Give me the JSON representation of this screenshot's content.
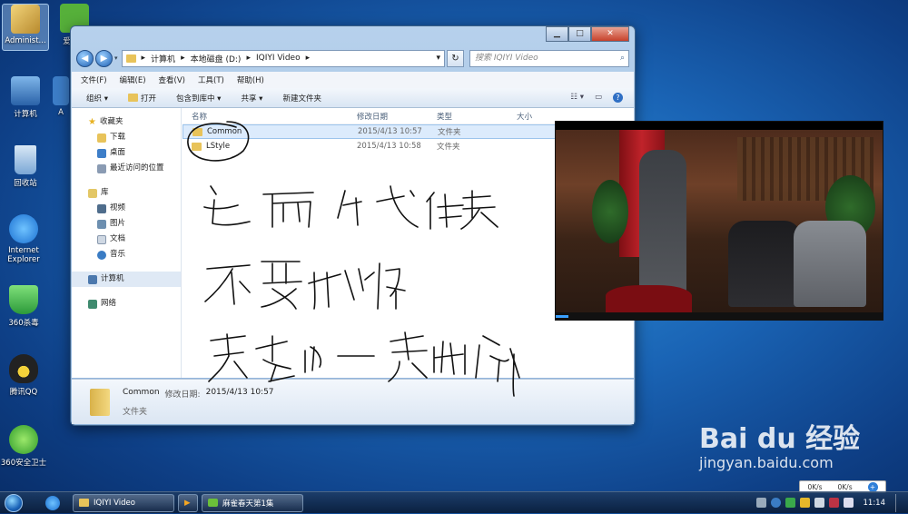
{
  "desktop": {
    "icons": [
      {
        "label": "Administ...",
        "color": "#caa24a"
      },
      {
        "label": "爱奇艺",
        "color": "#56b03a"
      },
      {
        "label": "计算机",
        "color": "#3d7ec8"
      },
      {
        "label": "A",
        "color": "#3d7ec8"
      },
      {
        "label": "回收站",
        "color": "#7aa7d6"
      },
      {
        "label": "Internet Explorer",
        "color": "#2f8fe0"
      },
      {
        "label": "360杀毒",
        "color": "#3aa84a"
      },
      {
        "label": "腾讯QQ",
        "color": "#222222"
      },
      {
        "label": "360安全卫士",
        "color": "#3fae3a"
      }
    ]
  },
  "explorer": {
    "breadcrumb": [
      "计算机",
      "本地磁盘 (D:)",
      "IQIYI Video"
    ],
    "search_placeholder": "搜索 IQIYI Video",
    "menu": [
      "文件(F)",
      "编辑(E)",
      "查看(V)",
      "工具(T)",
      "帮助(H)"
    ],
    "commands": [
      "组织 ▾",
      "打开",
      "包含到库中 ▾",
      "共享 ▾",
      "新建文件夹"
    ],
    "nav": {
      "favorites": "收藏夹",
      "favorites_items": [
        "下载",
        "桌面",
        "最近访问的位置"
      ],
      "libraries": "库",
      "libraries_items": [
        "视频",
        "图片",
        "文档",
        "音乐"
      ],
      "computer": "计算机",
      "network": "网络"
    },
    "columns": {
      "name": "名称",
      "date": "修改日期",
      "type": "类型",
      "size": "大小"
    },
    "files": [
      {
        "name": "Common",
        "date": "2015/4/13 10:57",
        "type": "文件夹"
      },
      {
        "name": "LStyle",
        "date": "2015/4/13 10:58",
        "type": "文件夹"
      }
    ],
    "details": {
      "name": "Common",
      "meta_label": "修改日期:",
      "meta_value": "2015/4/13 10:57",
      "type": "文件夹"
    }
  },
  "taskbar": {
    "buttons": [
      "IQIYI Video",
      "麻雀春天第1集"
    ],
    "clock": "11:14"
  },
  "netspeed": {
    "down": "0K/s",
    "up": "0K/s"
  },
  "watermark": {
    "main": "Bai du 经验",
    "sub": "jingyan.baidu.com"
  },
  "colors": {
    "accent": "#1d5fb3",
    "folder": "#e8c35a",
    "ink": "#111111"
  }
}
